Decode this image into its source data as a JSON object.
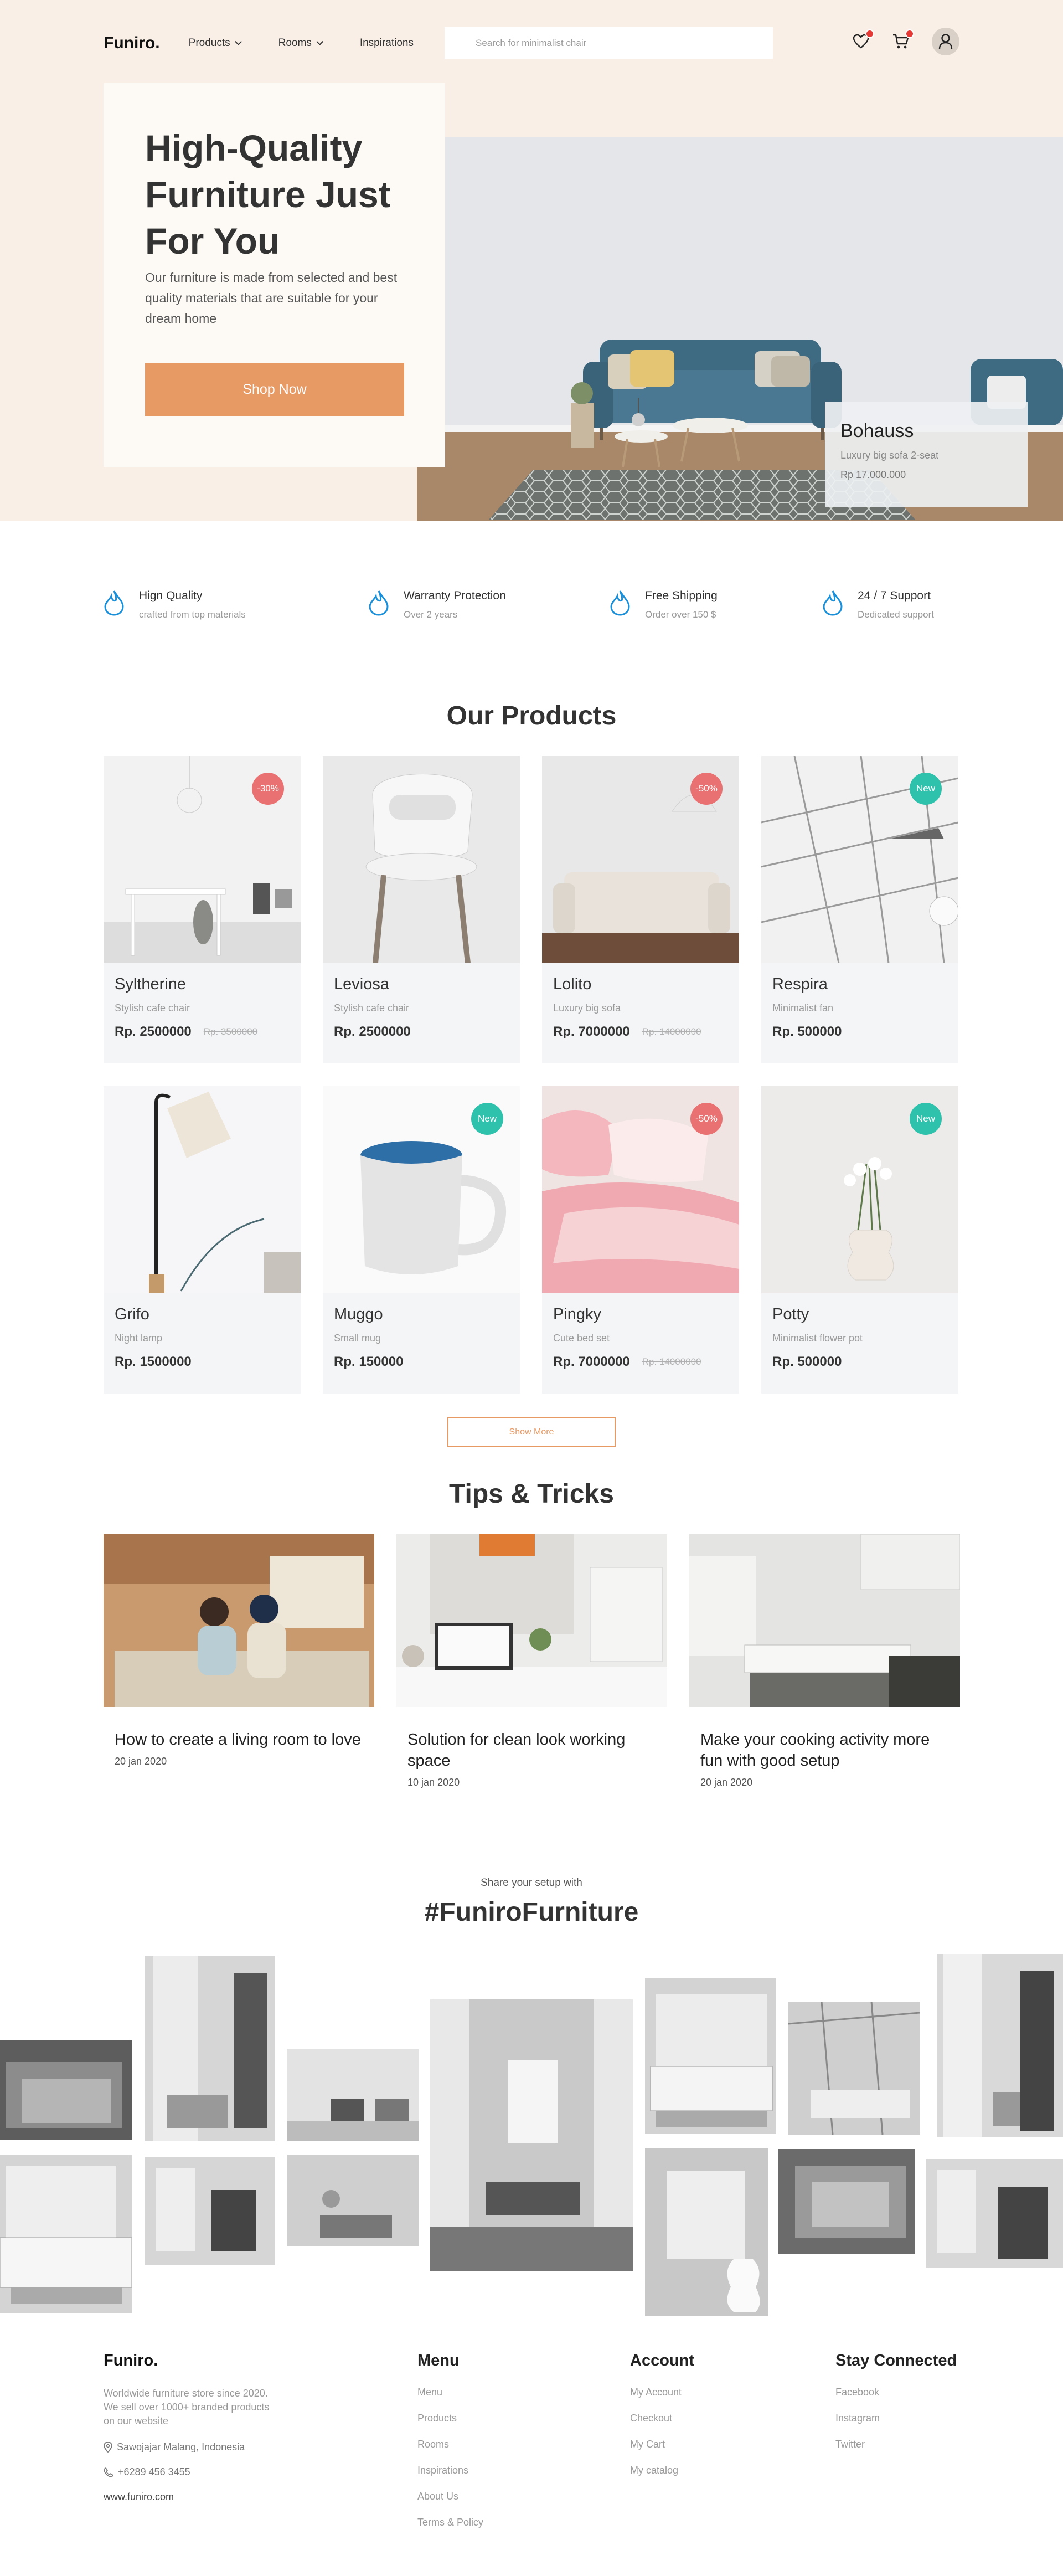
{
  "header": {
    "logo": "Funiro.",
    "nav": [
      {
        "label": "Products",
        "has_dropdown": true
      },
      {
        "label": "Rooms",
        "has_dropdown": true
      },
      {
        "label": "Inspirations",
        "has_dropdown": false
      }
    ],
    "search_placeholder": "Search for minimalist chair",
    "icons": [
      "heart-icon",
      "cart-icon",
      "user-icon"
    ],
    "badge_color": "#e53935"
  },
  "hero": {
    "title": "High-Quality Furniture Just For You",
    "subtitle": "Our furniture is made from selected and best quality materials that are suitable for your dream home",
    "cta": "Shop Now",
    "cta_color": "#e89a65",
    "promo": {
      "title": "Bohauss",
      "subtitle": "Luxury big sofa 2-seat",
      "price": "Rp 17.000.000"
    }
  },
  "features": [
    {
      "icon": "drop-icon",
      "title": "Hign Quality",
      "subtitle": "crafted from top materials"
    },
    {
      "icon": "drop-icon",
      "title": "Warranty Protection",
      "subtitle": "Over 2 years"
    },
    {
      "icon": "drop-icon",
      "title": "Free Shipping",
      "subtitle": "Order over 150 $"
    },
    {
      "icon": "drop-icon",
      "title": "24 / 7 Support",
      "subtitle": "Dedicated support"
    }
  ],
  "products": {
    "title": "Our Products",
    "items": [
      {
        "name": "Syltherine",
        "desc": "Stylish cafe chair",
        "price": "Rp. 2500000",
        "old_price": "Rp. 3500000",
        "tag": "-30%",
        "tag_type": "sale"
      },
      {
        "name": "Leviosa",
        "desc": "Stylish cafe chair",
        "price": "Rp. 2500000",
        "old_price": "",
        "tag": "",
        "tag_type": ""
      },
      {
        "name": "Lolito",
        "desc": "Luxury big sofa",
        "price": "Rp. 7000000",
        "old_price": "Rp. 14000000",
        "tag": "-50%",
        "tag_type": "sale"
      },
      {
        "name": "Respira",
        "desc": "Minimalist fan",
        "price": "Rp. 500000",
        "old_price": "",
        "tag": "New",
        "tag_type": "new"
      },
      {
        "name": "Grifo",
        "desc": "Night lamp",
        "price": "Rp. 1500000",
        "old_price": "",
        "tag": "",
        "tag_type": ""
      },
      {
        "name": "Muggo",
        "desc": "Small mug",
        "price": "Rp. 150000",
        "old_price": "",
        "tag": "New",
        "tag_type": "new"
      },
      {
        "name": "Pingky",
        "desc": "Cute bed set",
        "price": "Rp. 7000000",
        "old_price": "Rp. 14000000",
        "tag": "-50%",
        "tag_type": "sale"
      },
      {
        "name": "Potty",
        "desc": "Minimalist flower pot",
        "price": "Rp. 500000",
        "old_price": "",
        "tag": "New",
        "tag_type": "new"
      }
    ],
    "show_more": "Show More"
  },
  "tips": {
    "title": "Tips & Tricks",
    "items": [
      {
        "title": "How to create a living room to love",
        "date": "20 jan 2020"
      },
      {
        "title": "Solution for clean look working space",
        "date": "10 jan 2020"
      },
      {
        "title": "Make your cooking activity more fun with good setup",
        "date": "20 jan 2020"
      }
    ]
  },
  "gallery": {
    "subtitle": "Share your setup with",
    "title": "#FuniroFurniture"
  },
  "footer": {
    "logo": "Funiro.",
    "description": "Worldwide furniture store since 2020. We sell over 1000+ branded products on our website",
    "address": "Sawojajar Malang, Indonesia",
    "phone": "+6289 456 3455",
    "website": "www.funiro.com",
    "menu": {
      "title": "Menu",
      "links": [
        "Menu",
        "Products",
        "Rooms",
        "Inspirations",
        "About Us",
        "Terms & Policy"
      ]
    },
    "account": {
      "title": "Account",
      "links": [
        "My Account",
        "Checkout",
        "My Cart",
        "My catalog"
      ]
    },
    "social": {
      "title": "Stay Connected",
      "links": [
        "Facebook",
        "Instagram",
        "Twitter"
      ]
    }
  }
}
